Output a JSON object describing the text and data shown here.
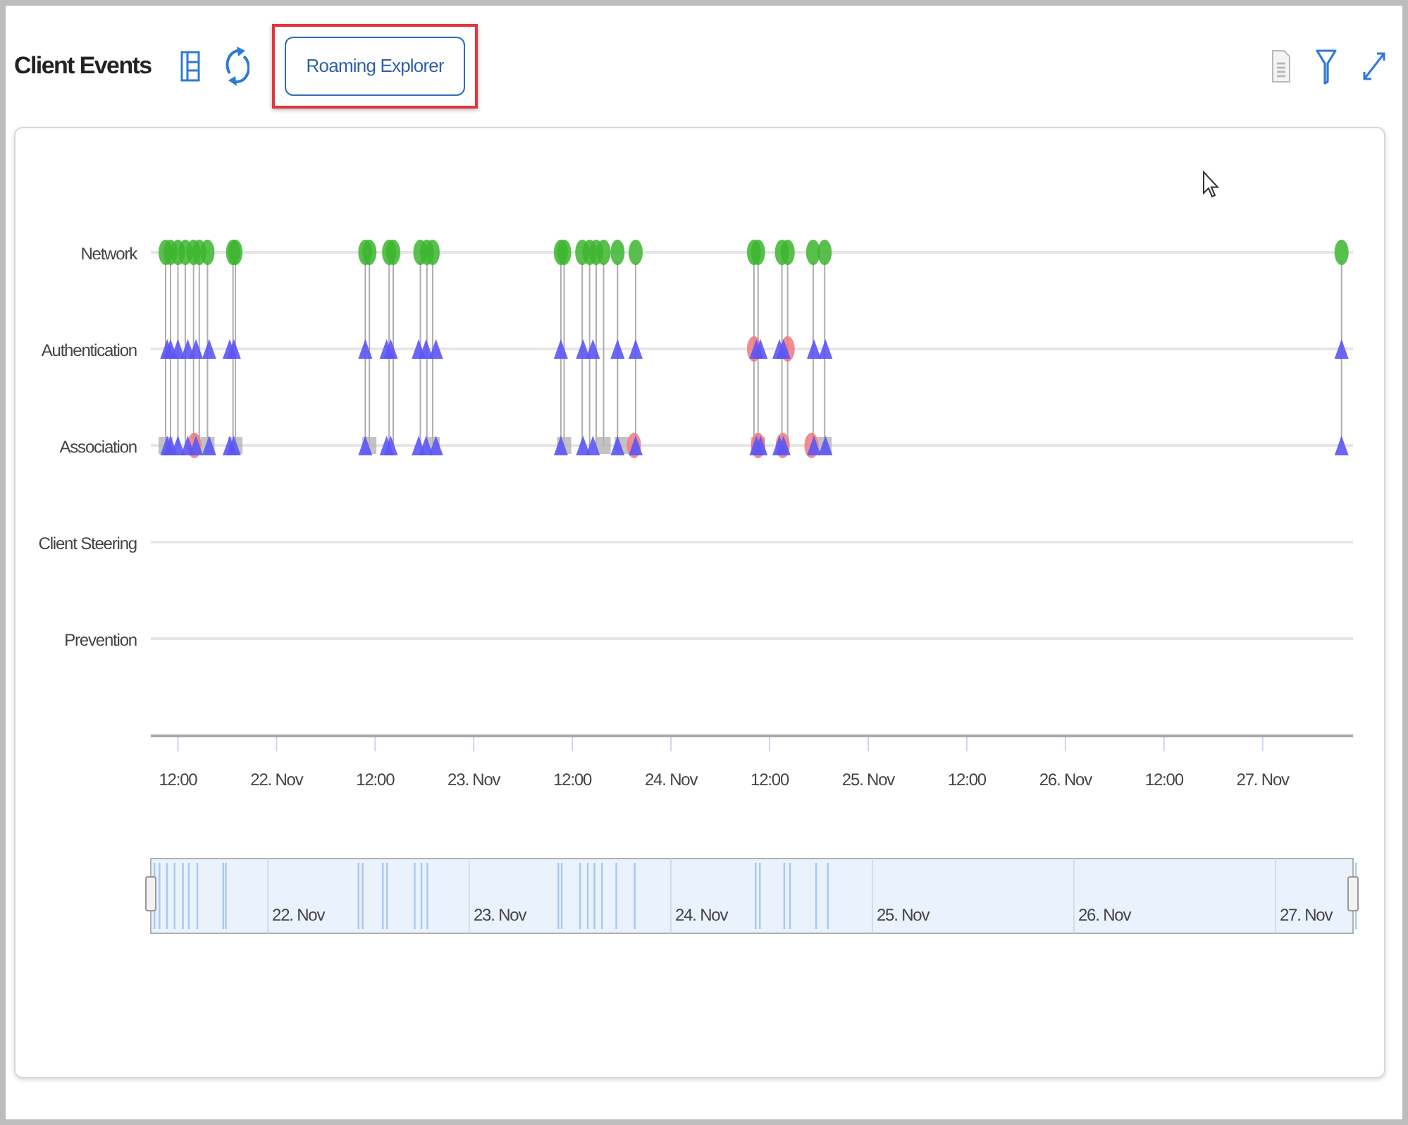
{
  "header": {
    "title": "Client Events",
    "left_tools": [
      {
        "kind": "table"
      },
      {
        "kind": "refresh"
      }
    ],
    "button": {
      "label": "Roaming Explorer",
      "highlighted": true
    },
    "right_tools": [
      {
        "kind": "export",
        "disabled": true
      },
      {
        "kind": "filter",
        "disabled": false
      },
      {
        "kind": "expand",
        "disabled": false
      }
    ]
  },
  "chart": {
    "y_labels": [
      "Network",
      "Authentication",
      "Association",
      "Client Steering",
      "Prevention"
    ],
    "x_labels": [
      "12:00",
      "22. Nov",
      "12:00",
      "23. Nov",
      "12:00",
      "24. Nov",
      "12:00",
      "25. Nov",
      "12:00",
      "26. Nov",
      "12:00",
      "27. Nov"
    ]
  },
  "navigator": {
    "labels": [
      "22. Nov",
      "23. Nov",
      "24. Nov",
      "25. Nov",
      "26. Nov",
      "27. Nov"
    ]
  }
}
